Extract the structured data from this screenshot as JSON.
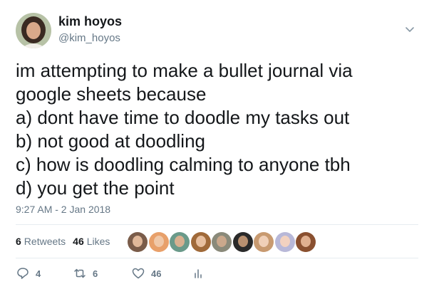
{
  "author": {
    "name": "kim hoyos",
    "handle": "@kim_hoyos"
  },
  "tweet": {
    "text": "im attempting to make a bullet journal via\ngoogle sheets because\na) dont have time to doodle my tasks out\nb) not good at doodling\nc) how is doodling calming to anyone tbh\nd) you get the point",
    "timestamp": "9:27 AM - 2 Jan 2018"
  },
  "stats": {
    "retweets_count": "6",
    "retweets_label": "Retweets",
    "likes_count": "46",
    "likes_label": "Likes"
  },
  "liker_avatars": [
    {
      "bg": "#7a5c4a",
      "skin": "#e0b89a"
    },
    {
      "bg": "#e8a06a",
      "skin": "#f0c8a8"
    },
    {
      "bg": "#6a9a8a",
      "skin": "#d8b090"
    },
    {
      "bg": "#a06a3a",
      "skin": "#e8c0a0"
    },
    {
      "bg": "#8a8a7a",
      "skin": "#caa88c"
    },
    {
      "bg": "#2a2a2a",
      "skin": "#b89070"
    },
    {
      "bg": "#c89a70",
      "skin": "#f0d0b8"
    },
    {
      "bg": "#b8b8d8",
      "skin": "#f2d2c0"
    },
    {
      "bg": "#8a5030",
      "skin": "#e0b090"
    }
  ],
  "actions": {
    "reply_count": "4",
    "retweet_count": "6",
    "like_count": "46"
  },
  "colors": {
    "text": "#14171a",
    "secondary": "#657786",
    "divider": "#e6ecf0"
  }
}
